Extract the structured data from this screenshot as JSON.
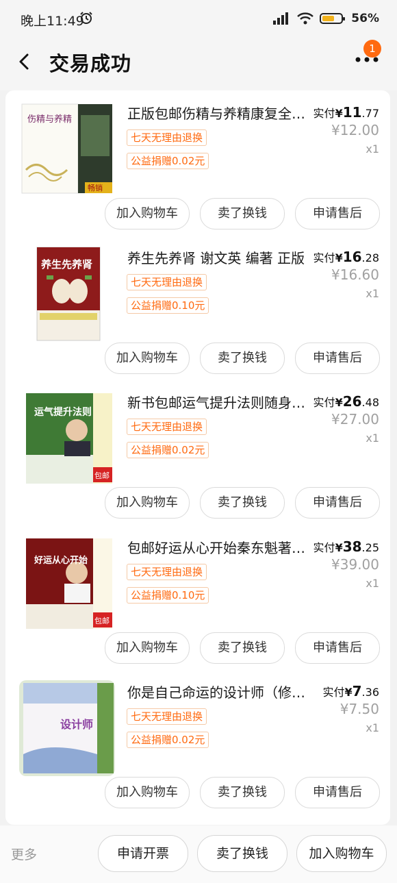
{
  "status_bar": {
    "time": "晚上11:49",
    "battery": "56%"
  },
  "header": {
    "title": "交易成功",
    "badge_count": "1"
  },
  "items": [
    {
      "name": "正版包邮伤精与养精康复全过程",
      "tag_return": "七天无理由退换",
      "tag_charity": "公益捐赠0.02元",
      "paid_label": "实付",
      "currency": "¥",
      "paid_int": "11",
      "paid_dec": ".77",
      "original": "¥12.00",
      "qty": "x1",
      "btn_cart": "加入购物车",
      "btn_sell": "卖了换钱",
      "btn_after": "申请售后"
    },
    {
      "name": "养生先养肾 谢文英 编著 正版",
      "tag_return": "七天无理由退换",
      "tag_charity": "公益捐赠0.10元",
      "paid_label": "实付",
      "currency": "¥",
      "paid_int": "16",
      "paid_dec": ".28",
      "original": "¥16.60",
      "qty": "x1",
      "btn_cart": "加入购物车",
      "btn_sell": "卖了换钱",
      "btn_after": "申请售后"
    },
    {
      "name": "新书包邮运气提升法则随身自查手册",
      "tag_return": "七天无理由退换",
      "tag_charity": "公益捐赠0.02元",
      "paid_label": "实付",
      "currency": "¥",
      "paid_int": "26",
      "paid_dec": ".48",
      "original": "¥27.00",
      "qty": "x1",
      "btn_cart": "加入购物车",
      "btn_sell": "卖了换钱",
      "btn_after": "申请售后"
    },
    {
      "name": "包邮好运从心开始秦东魁著正版",
      "tag_return": "七天无理由退换",
      "tag_charity": "公益捐赠0.10元",
      "paid_label": "实付",
      "currency": "¥",
      "paid_int": "38",
      "paid_dec": ".25",
      "original": "¥39.00",
      "qty": "x1",
      "btn_cart": "加入购物车",
      "btn_sell": "卖了换钱",
      "btn_after": "申请售后"
    },
    {
      "name": "你是自己命运的设计师（修订版）",
      "tag_return": "七天无理由退换",
      "tag_charity": "公益捐赠0.02元",
      "paid_label": "实付",
      "currency": "¥",
      "paid_int": "7",
      "paid_dec": ".36",
      "original": "¥7.50",
      "qty": "x1",
      "btn_cart": "加入购物车",
      "btn_sell": "卖了换钱",
      "btn_after": "申请售后"
    }
  ],
  "covers": [
    {
      "title": "伤精与养精",
      "stamp": "畅销"
    },
    {
      "title": "养生先养肾",
      "stamp": ""
    },
    {
      "title": "运气提升法则",
      "stamp": "包邮"
    },
    {
      "title": "好运从心开始",
      "stamp": "包邮"
    },
    {
      "title": "设计师",
      "stamp": ""
    }
  ],
  "bottom_bar": {
    "more": "更多",
    "invoice": "申请开票",
    "sell": "卖了换钱",
    "cart": "加入购物车"
  },
  "colors": {
    "accent": "#ff6a10",
    "tag_border": "#f5c9a6"
  }
}
